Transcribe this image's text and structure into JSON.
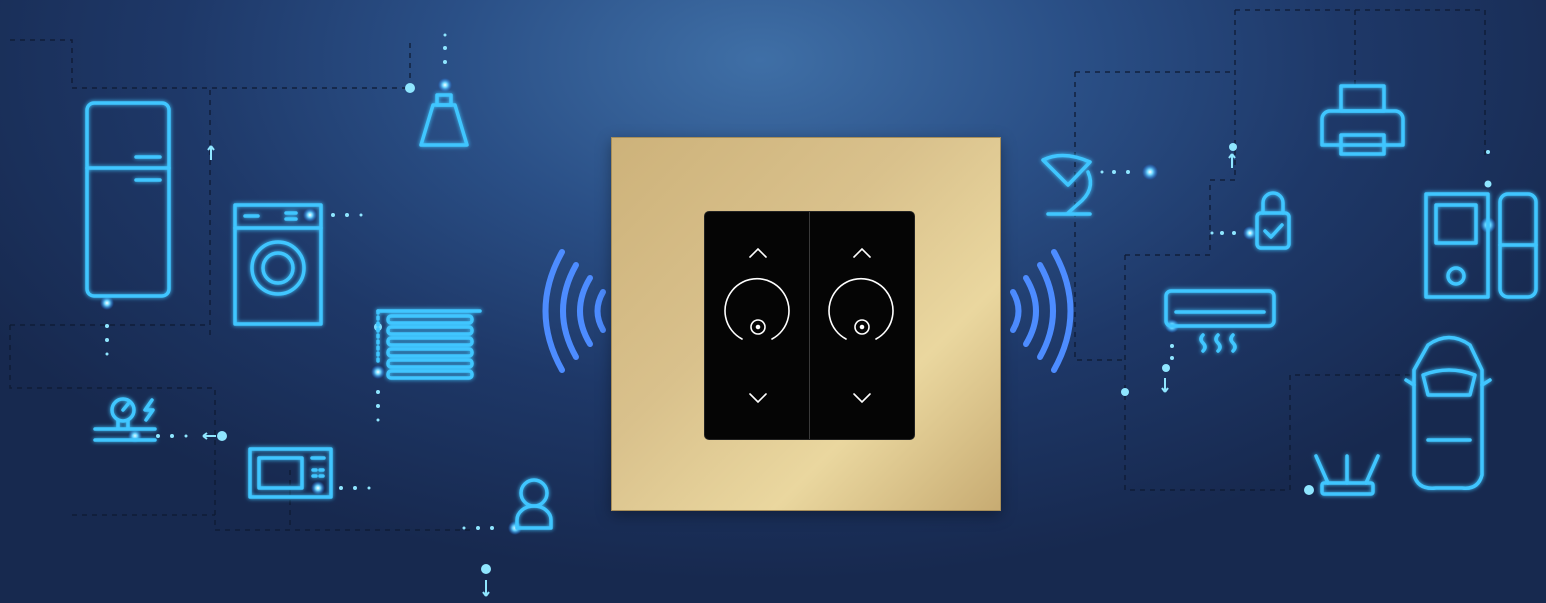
{
  "scene": {
    "accent_color": "#3fc6ff",
    "wave_color": "#4d8cff",
    "panel_color": "#d9c18c",
    "left_devices": [
      "refrigerator-icon",
      "washing-machine-icon",
      "pendant-lamp-icon",
      "window-blinds-icon",
      "water-meter-icon",
      "microwave-icon",
      "person-sensor-icon"
    ],
    "right_devices": [
      "desk-lamp-icon",
      "smart-lock-icon",
      "air-conditioner-icon",
      "printer-icon",
      "intercom-icon",
      "car-icon",
      "router-icon"
    ]
  },
  "switch_panel": {
    "keys": [
      {
        "up": "chevron-up-icon",
        "center": "dimmer-knob-icon",
        "down": "chevron-down-icon"
      },
      {
        "up": "chevron-up-icon",
        "center": "dimmer-knob-icon",
        "down": "chevron-down-icon"
      }
    ]
  }
}
